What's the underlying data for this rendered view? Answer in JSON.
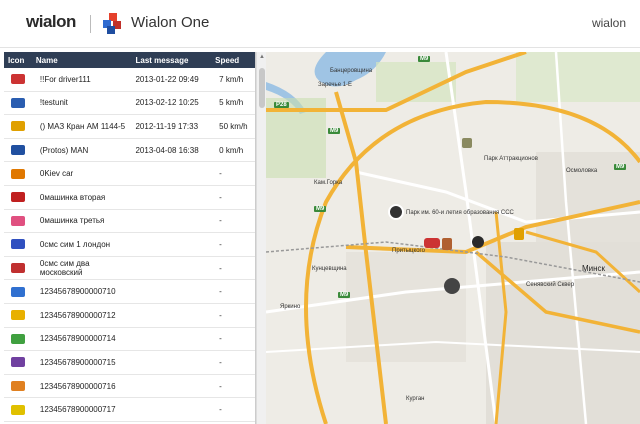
{
  "header": {
    "logo": "wialon",
    "app_title": "Wialon One",
    "user": "wialon"
  },
  "colors": {
    "header_bg": "#2f3e55",
    "accent": "#e5412c",
    "road": "#f2b337",
    "water": "#9fc4e4",
    "park": "#c9dfb0"
  },
  "table": {
    "columns": [
      "Icon",
      "Name",
      "Last message",
      "Speed"
    ],
    "rows": [
      {
        "icon": "red-truck-icon",
        "color": "#c33",
        "name": "!!For driver111",
        "last": "2013-01-22 09:49",
        "speed": "7 km/h"
      },
      {
        "icon": "blue-truck-icon",
        "color": "#2a5db0",
        "name": "!testunit",
        "last": "2013-02-12 10:25",
        "speed": "5 km/h"
      },
      {
        "icon": "yellow-crane-icon",
        "color": "#e0a000",
        "name": "() МАЗ Кран АМ 1144-5",
        "last": "2012-11-19 17:33",
        "speed": "50 km/h"
      },
      {
        "icon": "blue-van-icon",
        "color": "#2050a0",
        "name": "(Protos) MAN",
        "last": "2013-04-08 16:38",
        "speed": "0 km/h"
      },
      {
        "icon": "orange-truck-icon",
        "color": "#e07800",
        "name": "0Kiev car",
        "last": "",
        "speed": "-"
      },
      {
        "icon": "red-tram-icon",
        "color": "#c02020",
        "name": "0машинка вторая",
        "last": "",
        "speed": "-"
      },
      {
        "icon": "pink-car-icon",
        "color": "#e05080",
        "name": "0машинка третья",
        "last": "",
        "speed": "-"
      },
      {
        "icon": "blue-snowmobile-icon",
        "color": "#3050c0",
        "name": "0смс сим 1 лондон",
        "last": "",
        "speed": "-"
      },
      {
        "icon": "red-atv-icon",
        "color": "#c03030",
        "name": "0смс сим два московский",
        "last": "",
        "speed": "-"
      },
      {
        "icon": "blue-car-icon",
        "color": "#3070d0",
        "name": "12345678900000710",
        "last": "",
        "speed": "-"
      },
      {
        "icon": "yellow-truck-icon",
        "color": "#e8b000",
        "name": "12345678900000712",
        "last": "",
        "speed": "-"
      },
      {
        "icon": "green-car-icon",
        "color": "#40a040",
        "name": "12345678900000714",
        "last": "",
        "speed": "-"
      },
      {
        "icon": "purple-bus-icon",
        "color": "#7040a0",
        "name": "12345678900000715",
        "last": "",
        "speed": "-"
      },
      {
        "icon": "orange-loader-icon",
        "color": "#e08020",
        "name": "12345678900000716",
        "last": "",
        "speed": "-"
      },
      {
        "icon": "balloon-icon",
        "color": "#e0c000",
        "name": "12345678900000717",
        "last": "",
        "speed": "-"
      }
    ]
  },
  "map": {
    "labels": [
      {
        "text": "Банцеровщина",
        "big": false
      },
      {
        "text": "Заречье 1-Е",
        "big": false
      },
      {
        "text": "Парк Аттракционов",
        "big": false
      },
      {
        "text": "Осмоловка",
        "big": false
      },
      {
        "text": "Кам.Горка",
        "big": false
      },
      {
        "text": "Парк им. 60-и летия образования ССС",
        "big": false
      },
      {
        "text": "Минск",
        "big": true
      },
      {
        "text": "Кунцевщина",
        "big": false
      },
      {
        "text": "Сенявский Сквер",
        "big": false
      },
      {
        "text": "Яркино",
        "big": false
      },
      {
        "text": "Курган",
        "big": false
      },
      {
        "text": "Притыцкого",
        "big": false
      }
    ],
    "road_badges": [
      "M9",
      "M9",
      "M9",
      "M9",
      "P28",
      "M9"
    ]
  }
}
